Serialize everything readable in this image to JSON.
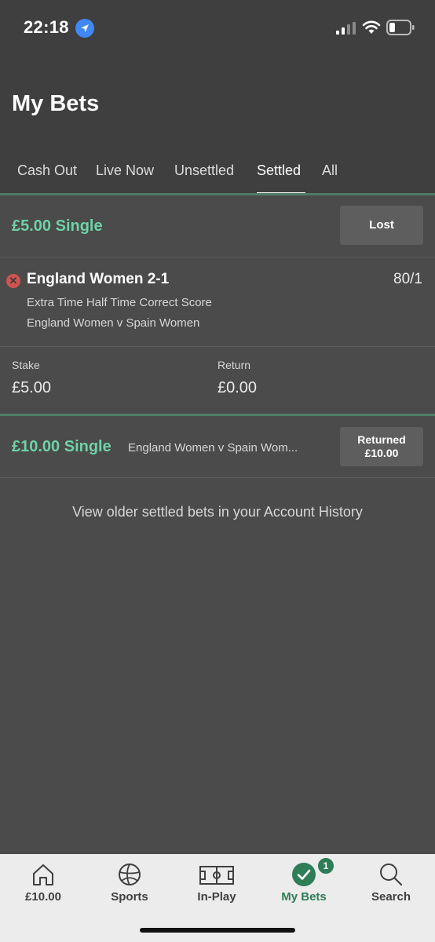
{
  "status_bar": {
    "time": "22:18",
    "icons": [
      "location-arrow-icon",
      "signal-icon",
      "wifi-icon",
      "battery-icon"
    ]
  },
  "header": {
    "title": "My Bets",
    "tabs": [
      {
        "label": "Cash Out",
        "active": false
      },
      {
        "label": "Live Now",
        "active": false
      },
      {
        "label": "Unsettled",
        "active": false
      },
      {
        "label": "Settled",
        "active": true
      },
      {
        "label": "All",
        "active": false
      }
    ]
  },
  "bets": [
    {
      "title": "£5.00 Single",
      "status": "Lost",
      "selection": {
        "result_icon": "lost-x-icon",
        "name": "England Women 2-1",
        "odds": "80/1",
        "market": "Extra Time Half Time Correct Score",
        "event": "England Women v Spain Women"
      },
      "stake_label": "Stake",
      "stake_value": "£5.00",
      "return_label": "Return",
      "return_value": "£0.00"
    },
    {
      "title": "£10.00 Single",
      "event": "England Women v Spain Wom...",
      "status_line1": "Returned",
      "status_line2": "£10.00"
    }
  ],
  "history_link": "View older settled bets in your Account History",
  "bottom_nav": [
    {
      "label": "£10.00",
      "icon": "home-icon",
      "active": false
    },
    {
      "label": "Sports",
      "icon": "football-icon",
      "active": false
    },
    {
      "label": "In-Play",
      "icon": "pitch-icon",
      "active": false
    },
    {
      "label": "My Bets",
      "icon": "check-circle-icon",
      "active": true,
      "badge": "1"
    },
    {
      "label": "Search",
      "icon": "search-icon",
      "active": false
    }
  ],
  "colors": {
    "accent_green": "#6ed2a6",
    "brand_green": "#2e7d57",
    "lost_red": "#cf5350",
    "background": "#4b4b4b",
    "header_background": "#3f3f3f"
  }
}
